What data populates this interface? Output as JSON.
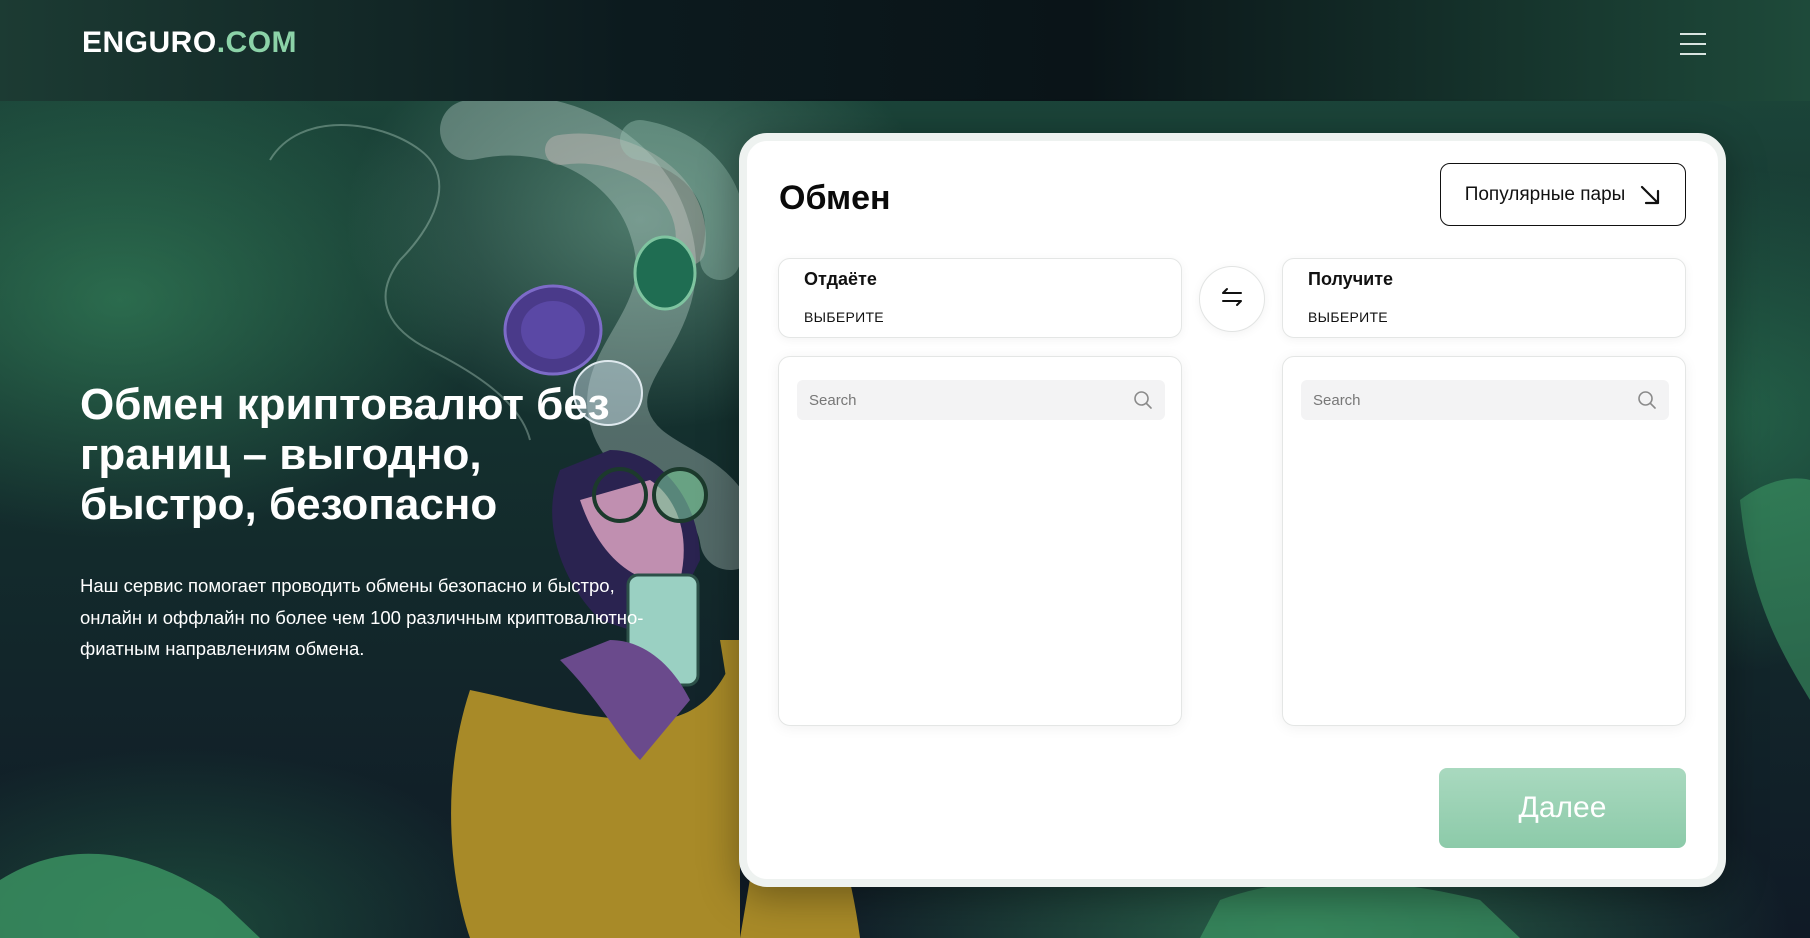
{
  "header": {
    "logo_main": "ENGURO",
    "logo_domain": ".COM"
  },
  "hero": {
    "title_line1": "Обмен криптовалют без",
    "title_line2": "границ – выгодно,",
    "title_line3": "быстро, безопасно",
    "desc_line1": "Наш сервис помогает проводить обмены безопасно и быстро,",
    "desc_line2": "онлайн и оффлайн по более чем 100 различным криптовалютно-",
    "desc_line3": "фиатным направлениям обмена."
  },
  "exchange": {
    "title": "Обмен",
    "popular_label": "Популярные пары",
    "give": {
      "label": "Отдаёте",
      "selector": "ВЫБЕРИТЕ",
      "search_placeholder": "Search"
    },
    "receive": {
      "label": "Получите",
      "selector": "ВЫБЕРИТЕ",
      "search_placeholder": "Search"
    },
    "next_label": "Далее"
  },
  "colors": {
    "accent": "#8cd3a8",
    "next_button": "#9dd3b7",
    "card_bg": "#ffffff"
  },
  "icons": {
    "menu": "hamburger-icon",
    "popular": "arrow-down-right-icon",
    "swap": "swap-arrows-icon",
    "search": "search-icon"
  }
}
